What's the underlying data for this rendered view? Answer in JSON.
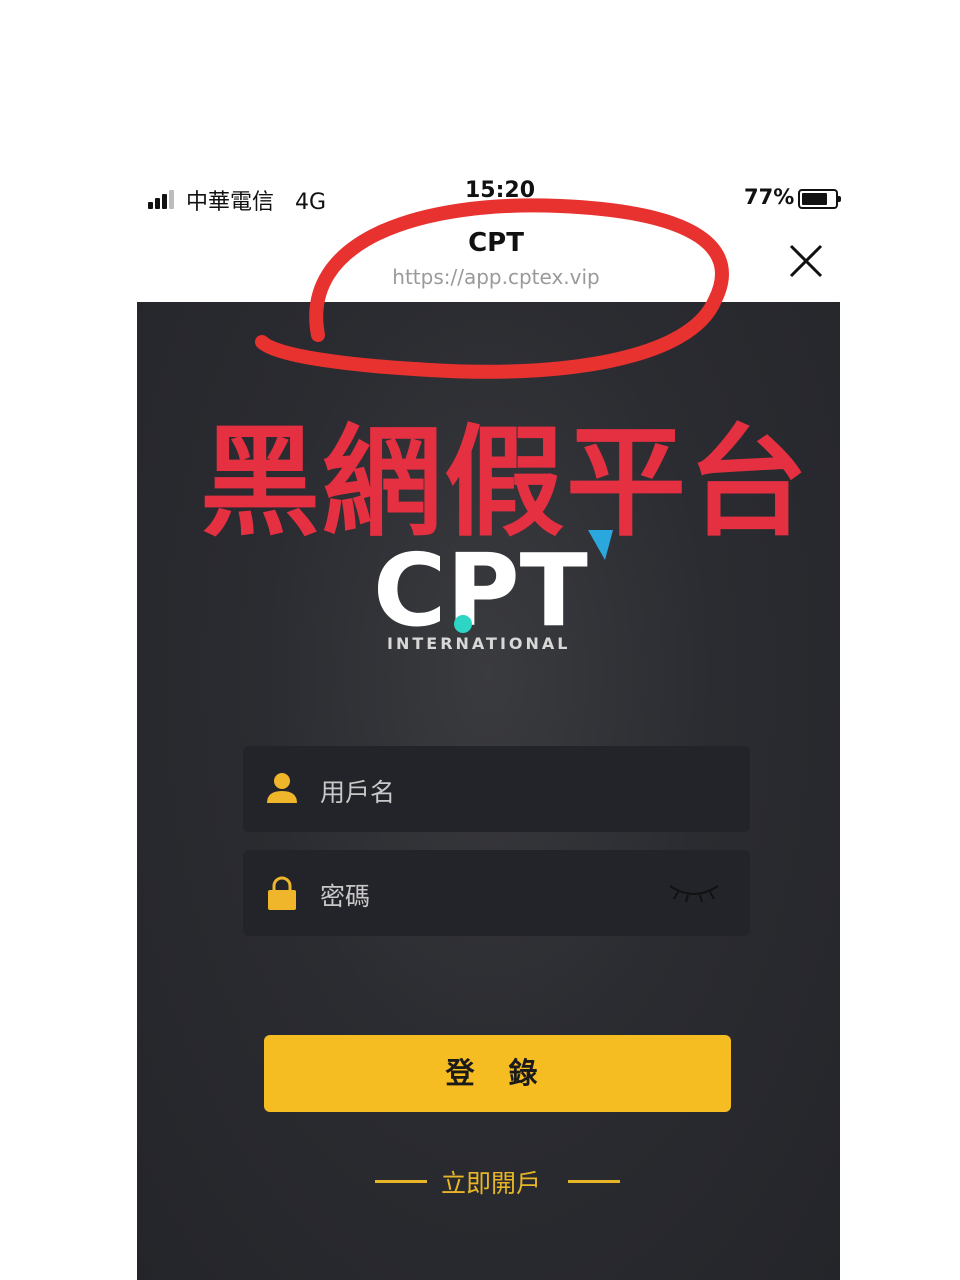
{
  "status_bar": {
    "carrier": "中華電信",
    "network": "4G",
    "time": "15:20",
    "battery_percent": "77%",
    "battery_level": 0.77
  },
  "browser": {
    "title": "CPT",
    "url": "https://app.cptex.vip"
  },
  "logo": {
    "wordmark": "CPT",
    "subtitle": "INTERNATIONAL"
  },
  "form": {
    "username_placeholder": "用戶名",
    "password_placeholder": "密碼",
    "login_label": "登 錄",
    "signup_label": "立即開戶"
  },
  "annotation": {
    "warning_text": "黑網假平台"
  },
  "colors": {
    "accent_yellow": "#f5bd22",
    "background_dark": "#2b2c31",
    "annotation_red": "#e53042",
    "logo_teal": "#2cd5c4"
  }
}
